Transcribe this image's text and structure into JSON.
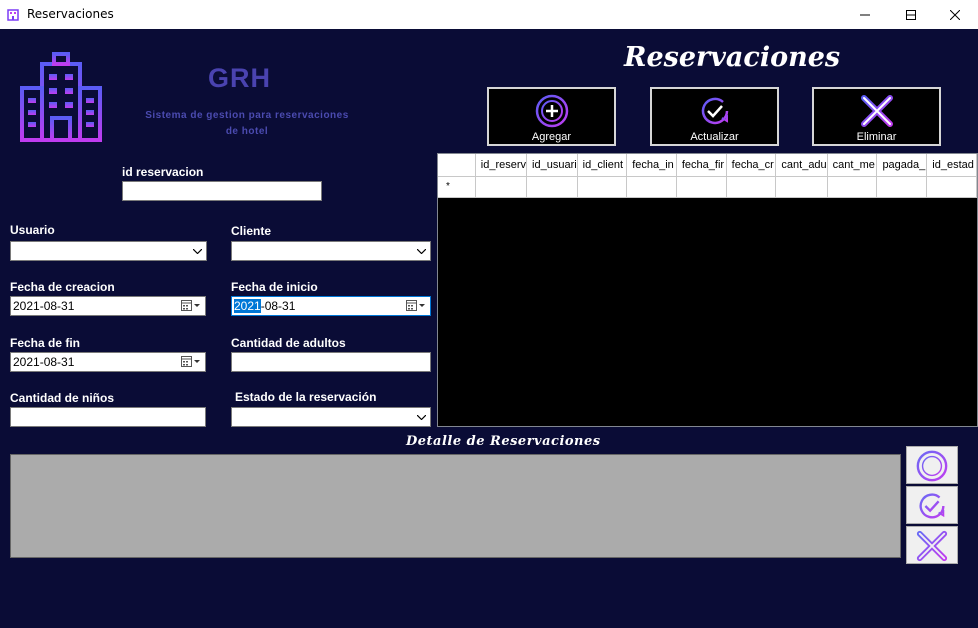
{
  "window": {
    "title": "Reservaciones"
  },
  "brand": {
    "name": "GRH",
    "tagline_line1": "Sistema de gestion para reservaciones",
    "tagline_line2": "de hotel",
    "logo_icon": "hotel-building-icon"
  },
  "headline": "Reservaciones",
  "actions": [
    {
      "label": "Agregar",
      "icon": "add-circle-icon"
    },
    {
      "label": "Actualizar",
      "icon": "refresh-check-icon"
    },
    {
      "label": "Eliminar",
      "icon": "close-x-icon"
    }
  ],
  "form": {
    "id_reservacion": {
      "label": "id reservacion",
      "value": ""
    },
    "usuario": {
      "label": "Usuario",
      "value": ""
    },
    "cliente": {
      "label": "Cliente",
      "value": ""
    },
    "fecha_creacion": {
      "label": "Fecha de creacion",
      "value": "2021-08-31"
    },
    "fecha_inicio": {
      "label": "Fecha de inicio",
      "value_selected": "2021",
      "value_rest": "-08-31"
    },
    "fecha_fin": {
      "label": "Fecha de fin",
      "value": "2021-08-31"
    },
    "cantidad_adultos": {
      "label": "Cantidad de adultos",
      "value": ""
    },
    "cantidad_ninos": {
      "label": "Cantidad de niños",
      "value": ""
    },
    "estado_reservacion": {
      "label": "Estado de la reservación",
      "value": ""
    }
  },
  "grid": {
    "columns": [
      "id_reserv",
      "id_usuari",
      "id_client",
      "fecha_in",
      "fecha_fir",
      "fecha_cr",
      "cant_adu",
      "cant_me",
      "pagada_",
      "id_estad"
    ],
    "new_row_marker": "*"
  },
  "detail": {
    "title": "Detalle de Reservaciones"
  },
  "detail_actions": [
    "add-circle-icon",
    "refresh-check-icon",
    "close-x-icon"
  ],
  "colors": {
    "background": "#0a0c36",
    "accent_purple": "#7b3cf5",
    "accent_magenta": "#c03cf0",
    "brand_text": "#4a43b0"
  }
}
